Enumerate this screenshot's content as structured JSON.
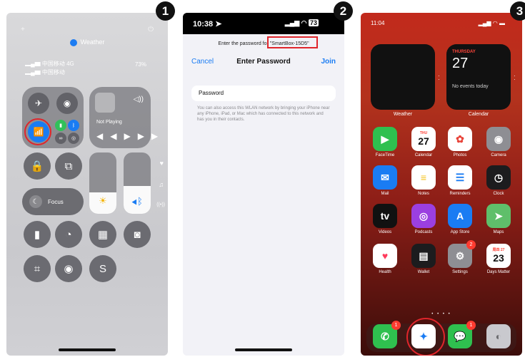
{
  "steps": [
    "1",
    "2",
    "3"
  ],
  "panel1": {
    "top_plus": "+",
    "top_power": "⏻",
    "weather_label": "Weather",
    "carrier1": "中国移动 4G",
    "carrier2": "中国移动",
    "battery": "73%",
    "now_playing": "Not Playing",
    "focus_label": "Focus",
    "brightness_level": 0.35,
    "volume_level": 0.45
  },
  "panel2": {
    "time": "10:38",
    "battery": "73",
    "prompt_prefix": "Enter the password for",
    "network_name": "\"SmartBox-15D5\"",
    "cancel_label": "Cancel",
    "title": "Enter Password",
    "join_label": "Join",
    "password_label": "Password",
    "help_text": "You can also access this WLAN network by bringing your iPhone near any iPhone, iPad, or Mac which has connected to this network and has you in their contacts."
  },
  "panel3": {
    "time": "11:04",
    "weather_widget_label": "Weather",
    "calendar_widget_label": "Calendar",
    "calendar_day": "THURSDAY",
    "calendar_date": "27",
    "calendar_events": "No events today",
    "apps": [
      {
        "label": "FaceTime",
        "glyph": "▶",
        "color": "#2fc04f"
      },
      {
        "label": "Calendar",
        "glyph": "27",
        "color": "#ffffff",
        "text_color": "#111111",
        "sub": "THU"
      },
      {
        "label": "Photos",
        "glyph": "✿",
        "color": "#ffffff",
        "text_color": "#e8443a"
      },
      {
        "label": "Camera",
        "glyph": "◉",
        "color": "#8e8e93"
      },
      {
        "label": "Mail",
        "glyph": "✉",
        "color": "#1a7cf3"
      },
      {
        "label": "Notes",
        "glyph": "≡",
        "color": "#ffffff",
        "text_color": "#f4c21a"
      },
      {
        "label": "Reminders",
        "glyph": "☰",
        "color": "#ffffff",
        "text_color": "#1a7cf3"
      },
      {
        "label": "Clock",
        "glyph": "◷",
        "color": "#1c1c1e"
      },
      {
        "label": "Videos",
        "glyph": "tv",
        "color": "#111111"
      },
      {
        "label": "Podcasts",
        "glyph": "◎",
        "color": "#9b3fe0"
      },
      {
        "label": "App Store",
        "glyph": "A",
        "color": "#1a7cf3"
      },
      {
        "label": "Maps",
        "glyph": "➤",
        "color": "#5fbf6a"
      },
      {
        "label": "Health",
        "glyph": "♥",
        "color": "#ffffff",
        "text_color": "#ff3b5c"
      },
      {
        "label": "Wallet",
        "glyph": "▤",
        "color": "#1c1c1e"
      },
      {
        "label": "Settings",
        "glyph": "⚙",
        "color": "#8e8e93",
        "badge": "2"
      },
      {
        "label": "Days Matter",
        "glyph": "23",
        "color": "#ffffff",
        "text_color": "#111111",
        "sub": "周四 27"
      }
    ],
    "dock": [
      {
        "name": "phone",
        "glyph": "✆",
        "color": "#2fc04f",
        "badge": "1"
      },
      {
        "name": "safari",
        "glyph": "✦",
        "color": "#ffffff",
        "text_color": "#1a7cf3"
      },
      {
        "name": "messages",
        "glyph": "💬",
        "color": "#2fc04f",
        "badge": "1"
      },
      {
        "name": "contacts",
        "glyph": "◐",
        "color": "#c9c9ce",
        "text_color": "#6a6a6e"
      }
    ],
    "page_dots": "• • • •"
  },
  "colors": {
    "highlight_red": "#e0252b",
    "ios_blue": "#1a7cf3"
  }
}
